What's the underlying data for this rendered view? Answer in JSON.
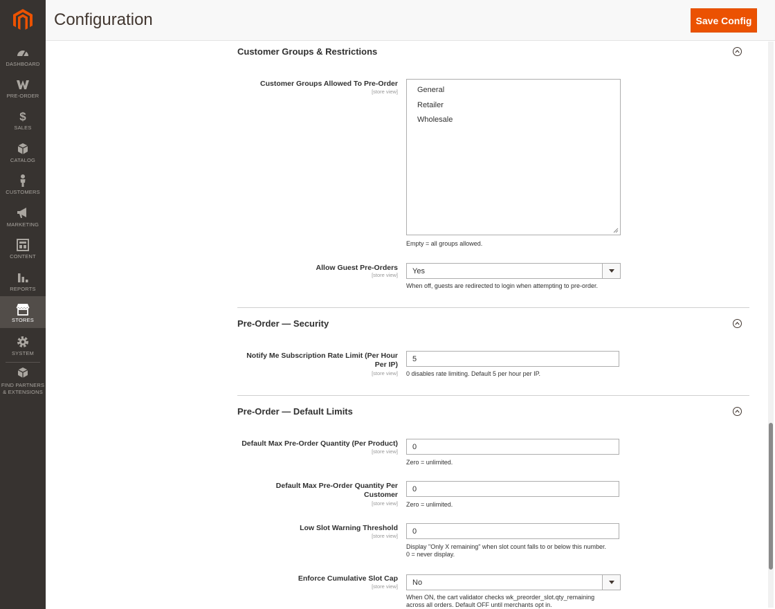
{
  "page": {
    "title": "Configuration",
    "save_label": "Save Config"
  },
  "colors": {
    "accent": "#eb5202",
    "sidebar_bg": "#373330",
    "sidebar_active": "#524d49"
  },
  "sidebar": {
    "items": [
      {
        "label": "DASHBOARD",
        "icon": "dashboard-icon"
      },
      {
        "label": "PRE-ORDER",
        "icon": "preorder-icon"
      },
      {
        "label": "SALES",
        "icon": "dollar-icon"
      },
      {
        "label": "CATALOG",
        "icon": "box-icon"
      },
      {
        "label": "CUSTOMERS",
        "icon": "person-icon"
      },
      {
        "label": "MARKETING",
        "icon": "megaphone-icon"
      },
      {
        "label": "CONTENT",
        "icon": "layout-icon"
      },
      {
        "label": "REPORTS",
        "icon": "bar-chart-icon"
      },
      {
        "label": "STORES",
        "icon": "store-icon",
        "active": true
      },
      {
        "label": "SYSTEM",
        "icon": "gear-icon"
      },
      {
        "label": "FIND PARTNERS",
        "label2": "& EXTENSIONS",
        "icon": "cubes-icon"
      }
    ]
  },
  "sections": {
    "groups": {
      "title": "Customer Groups & Restrictions",
      "groups_allowed": {
        "label": "Customer Groups Allowed To Pre-Order",
        "scope": "[store view]",
        "options": [
          "General",
          "Retailer",
          "Wholesale"
        ],
        "note": "Empty = all groups allowed."
      },
      "guest": {
        "label": "Allow Guest Pre-Orders",
        "scope": "[store view]",
        "value": "Yes",
        "note": "When off, guests are redirected to login when attempting to pre-order."
      }
    },
    "security": {
      "title": "Pre-Order — Security",
      "rate_limit": {
        "label_line1": "Notify Me Subscription Rate Limit (Per Hour",
        "label_line2": "Per IP)",
        "scope": "[store view]",
        "value": "5",
        "note": "0 disables rate limiting. Default 5 per hour per IP."
      }
    },
    "limits": {
      "title": "Pre-Order — Default Limits",
      "max_per_product": {
        "label": "Default Max Pre-Order Quantity (Per Product)",
        "scope": "[store view]",
        "value": "0",
        "note": "Zero = unlimited."
      },
      "max_per_customer": {
        "label_line1": "Default Max Pre-Order Quantity Per",
        "label_line2": "Customer",
        "scope": "[store view]",
        "value": "0",
        "note": "Zero = unlimited."
      },
      "low_slot": {
        "label": "Low Slot Warning Threshold",
        "scope": "[store view]",
        "value": "0",
        "note_line1": "Display \"Only X remaining\" when slot count falls to or below this number.",
        "note_line2": "0 = never display."
      },
      "cumulative_cap": {
        "label": "Enforce Cumulative Slot Cap",
        "scope": "[store view]",
        "value": "No",
        "note_line1": "When ON, the cart validator checks wk_preorder_slot.qty_remaining",
        "note_line2": "across all orders. Default OFF until merchants opt in."
      }
    }
  }
}
